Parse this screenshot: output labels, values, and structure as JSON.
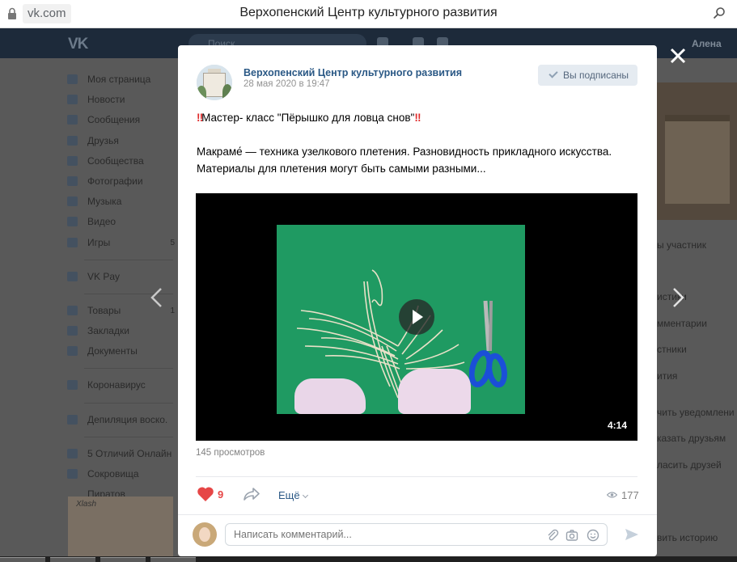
{
  "browser": {
    "url": "vk.com",
    "title": "Верхопенский Центр культурного развития"
  },
  "vk_header": {
    "search_placeholder": "Поиск",
    "user_name": "Алена"
  },
  "sidebar": {
    "items": [
      {
        "label": "Моя страница",
        "icon": "home-icon"
      },
      {
        "label": "Новости",
        "icon": "news-icon"
      },
      {
        "label": "Сообщения",
        "icon": "message-icon"
      },
      {
        "label": "Друзья",
        "icon": "friends-icon"
      },
      {
        "label": "Сообщества",
        "icon": "groups-icon"
      },
      {
        "label": "Фотографии",
        "icon": "photo-icon"
      },
      {
        "label": "Музыка",
        "icon": "music-icon"
      },
      {
        "label": "Видео",
        "icon": "video-icon"
      },
      {
        "label": "Игры",
        "icon": "games-icon",
        "count": "5"
      }
    ],
    "pay": {
      "label": "VK Pay",
      "icon": "vkpay-icon"
    },
    "items2": [
      {
        "label": "Товары",
        "icon": "goods-icon",
        "count": "1"
      },
      {
        "label": "Закладки",
        "icon": "bookmark-icon"
      },
      {
        "label": "Документы",
        "icon": "docs-icon"
      }
    ],
    "corona": {
      "label": "Коронавирус",
      "icon": "virus-icon"
    },
    "app1": {
      "label": "Депиляция воско.",
      "icon": "app-icon"
    },
    "apps": [
      {
        "label": "5 Отличий Онлайн",
        "icon": "app-icon"
      },
      {
        "label": "Сокровища Пиратов",
        "icon": "app-icon"
      }
    ],
    "ad_text": "Xlash"
  },
  "right_column": {
    "participant_label": "ы участник",
    "lines": [
      "истики",
      "мментарии",
      "стники",
      "ития",
      "чить уведомлени",
      "казать друзьям",
      "ласить друзей",
      "вить историю"
    ]
  },
  "post": {
    "group_name": "Верхопенский Центр культурного развития",
    "date": "28 мая 2020 в 19:47",
    "subscribe_label": "Вы подписаны",
    "title_marks_left": "‼",
    "title": "Мастер- класс \"Пёрышко для ловца снов\"",
    "title_marks_right": "‼",
    "text_line1": "Макраме́ — техника узелкового плетения. Разновидность прикладного искусства.",
    "text_line2": "Материалы для плетения могут быть самыми разными...",
    "video": {
      "duration": "4:14"
    },
    "views_text": "145 просмотров",
    "likes": "9",
    "more_label": "Ещё",
    "view_count": "177",
    "comment_placeholder": "Написать комментарий..."
  },
  "colors": {
    "link": "#2a5885",
    "like_red": "#e64646",
    "felt_green": "#1f9a62",
    "scissors_blue": "#1b4fd8"
  }
}
